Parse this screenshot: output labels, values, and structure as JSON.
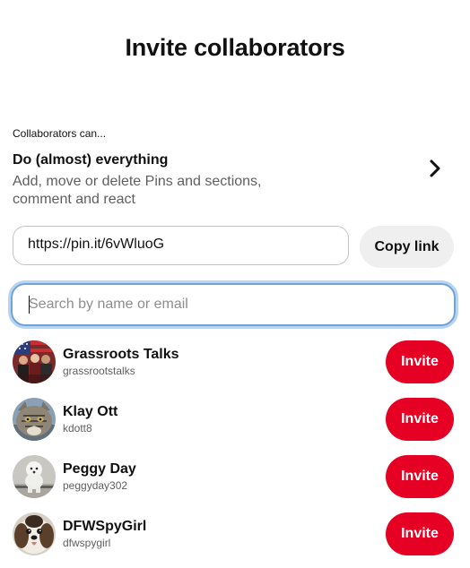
{
  "modal": {
    "title": "Invite collaborators"
  },
  "permissions": {
    "caption": "Collaborators can...",
    "level": "Do (almost) everything",
    "description": "Add, move or delete Pins and sections, comment and react",
    "chevron_icon": "chevron-right-icon"
  },
  "share_link": {
    "url": "https://pin.it/6vWluoG",
    "copy_label": "Copy link"
  },
  "search": {
    "placeholder": "Search by name or email",
    "value": ""
  },
  "accent_color": "#e60023",
  "users": [
    {
      "name": "Grassroots Talks",
      "handle": "grassrootstalks",
      "invite_label": "Invite",
      "avatar": "grassroots-avatar"
    },
    {
      "name": "Klay Ott",
      "handle": "kdott8",
      "invite_label": "Invite",
      "avatar": "cat-avatar"
    },
    {
      "name": "Peggy Day",
      "handle": "peggyday302",
      "invite_label": "Invite",
      "avatar": "white-dog-avatar"
    },
    {
      "name": "DFWSpyGirl",
      "handle": "dfwspygirl",
      "invite_label": "Invite",
      "avatar": "shih-tzu-avatar"
    }
  ]
}
